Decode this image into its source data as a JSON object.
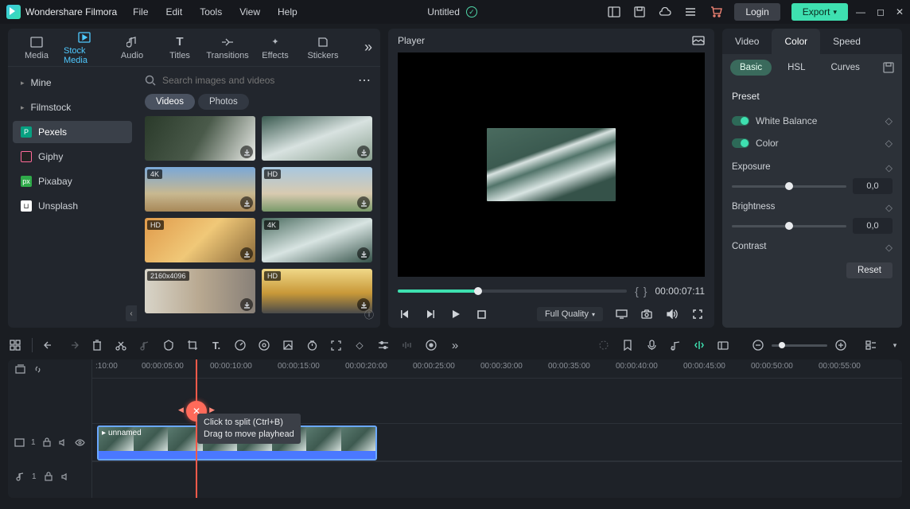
{
  "app": {
    "name": "Wondershare Filmora",
    "doc_title": "Untitled"
  },
  "menu": {
    "file": "File",
    "edit": "Edit",
    "tools": "Tools",
    "view": "View",
    "help": "Help"
  },
  "top": {
    "login": "Login",
    "export": "Export"
  },
  "library": {
    "tabs": {
      "media": "Media",
      "stock": "Stock Media",
      "audio": "Audio",
      "titles": "Titles",
      "transitions": "Transitions",
      "effects": "Effects",
      "stickers": "Stickers"
    },
    "sources": {
      "mine": "Mine",
      "filmstock": "Filmstock",
      "pexels": "Pexels",
      "giphy": "Giphy",
      "pixabay": "Pixabay",
      "unsplash": "Unsplash"
    },
    "search_placeholder": "Search images and videos",
    "filters": {
      "videos": "Videos",
      "photos": "Photos"
    },
    "thumbs": [
      {
        "badge": ""
      },
      {
        "badge": ""
      },
      {
        "badge": "4K"
      },
      {
        "badge": "HD"
      },
      {
        "badge": "HD"
      },
      {
        "badge": "4K"
      },
      {
        "badge": "2160x4096"
      },
      {
        "badge": "HD"
      }
    ]
  },
  "player": {
    "title": "Player",
    "timecode": "00:00:07:11",
    "quality": "Full Quality"
  },
  "inspector": {
    "tabs": {
      "video": "Video",
      "color": "Color",
      "speed": "Speed"
    },
    "subtabs": {
      "basic": "Basic",
      "hsl": "HSL",
      "curves": "Curves"
    },
    "preset_label": "Preset",
    "wb": "White Balance",
    "color": "Color",
    "exposure": "Exposure",
    "brightness": "Brightness",
    "contrast": "Contrast",
    "exposure_val": "0,0",
    "brightness_val": "0,0",
    "reset": "Reset"
  },
  "timeline": {
    "ticks": [
      ":10:00",
      "00:00:05:00",
      "00:00:10:00",
      "00:00:15:00",
      "00:00:20:00",
      "00:00:25:00",
      "00:00:30:00",
      "00:00:35:00",
      "00:00:40:00",
      "00:00:45:00",
      "00:00:50:00",
      "00:00:55:00"
    ],
    "video_track_badge": "1",
    "audio_track_badge": "1",
    "clip_name": "unnamed",
    "tooltip_l1": "Click to split (Ctrl+B)",
    "tooltip_l2": "Drag to move playhead"
  }
}
